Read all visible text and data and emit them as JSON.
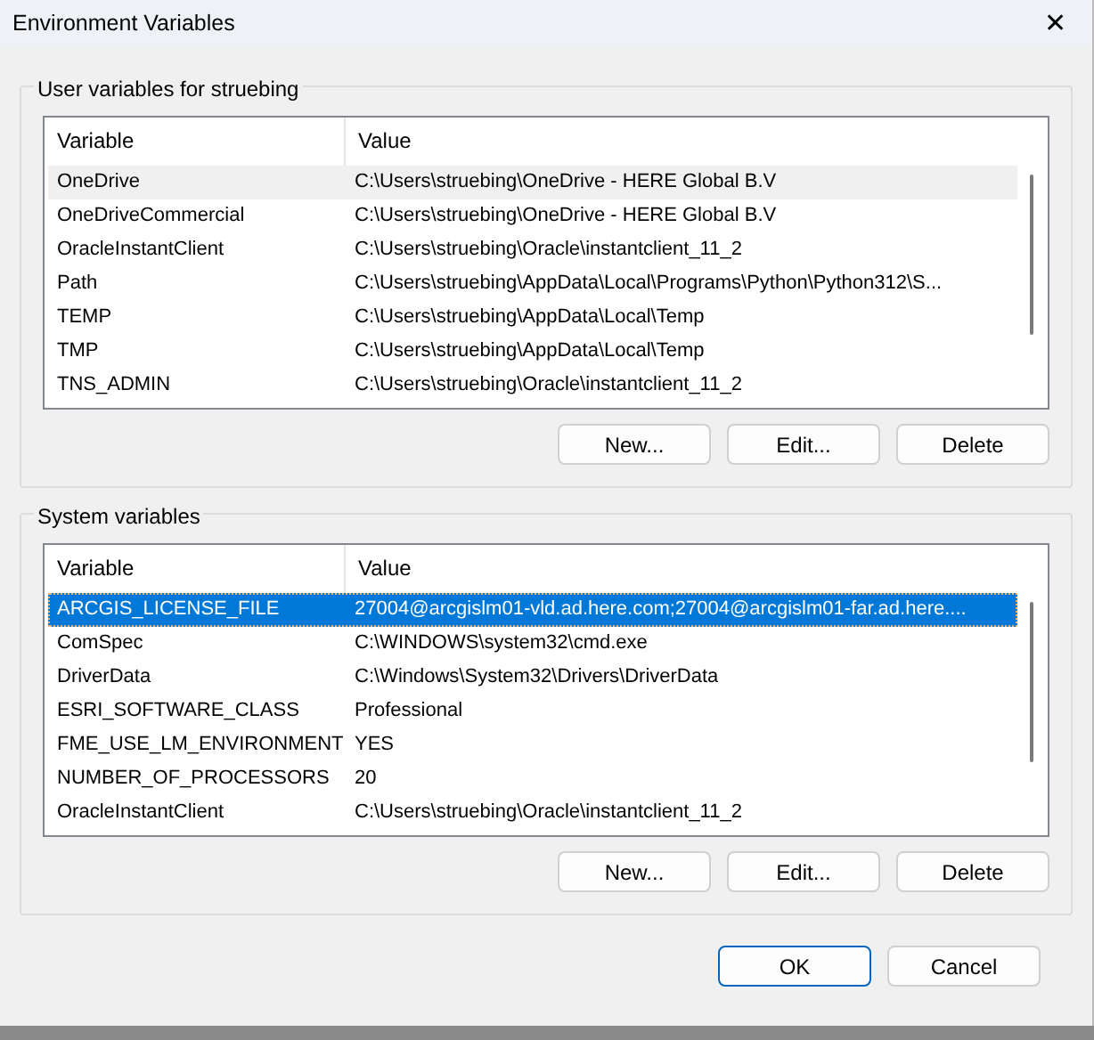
{
  "window": {
    "title": "Environment Variables",
    "close_glyph": "✕"
  },
  "groups": [
    {
      "title": "User variables for struebing",
      "focused": false,
      "columns": [
        "Variable",
        "Value"
      ],
      "rows": [
        {
          "variable": "OneDrive",
          "value": "C:\\Users\\struebing\\OneDrive - HERE Global B.V",
          "selected": true
        },
        {
          "variable": "OneDriveCommercial",
          "value": "C:\\Users\\struebing\\OneDrive - HERE Global B.V",
          "selected": false
        },
        {
          "variable": "OracleInstantClient",
          "value": "C:\\Users\\struebing\\Oracle\\instantclient_11_2",
          "selected": false
        },
        {
          "variable": "Path",
          "value": "C:\\Users\\struebing\\AppData\\Local\\Programs\\Python\\Python312\\S...",
          "selected": false
        },
        {
          "variable": "TEMP",
          "value": "C:\\Users\\struebing\\AppData\\Local\\Temp",
          "selected": false
        },
        {
          "variable": "TMP",
          "value": "C:\\Users\\struebing\\AppData\\Local\\Temp",
          "selected": false
        },
        {
          "variable": "TNS_ADMIN",
          "value": "C:\\Users\\struebing\\Oracle\\instantclient_11_2",
          "selected": false
        }
      ],
      "buttons": [
        "New...",
        "Edit...",
        "Delete"
      ]
    },
    {
      "title": "System variables",
      "focused": true,
      "columns": [
        "Variable",
        "Value"
      ],
      "rows": [
        {
          "variable": "ARCGIS_LICENSE_FILE",
          "value": "27004@arcgislm01-vld.ad.here.com;27004@arcgislm01-far.ad.here....",
          "selected": true
        },
        {
          "variable": "ComSpec",
          "value": "C:\\WINDOWS\\system32\\cmd.exe",
          "selected": false
        },
        {
          "variable": "DriverData",
          "value": "C:\\Windows\\System32\\Drivers\\DriverData",
          "selected": false
        },
        {
          "variable": "ESRI_SOFTWARE_CLASS",
          "value": "Professional",
          "selected": false
        },
        {
          "variable": "FME_USE_LM_ENVIRONMENT",
          "value": "YES",
          "selected": false
        },
        {
          "variable": "NUMBER_OF_PROCESSORS",
          "value": "20",
          "selected": false
        },
        {
          "variable": "OracleInstantClient",
          "value": "C:\\Users\\struebing\\Oracle\\instantclient_11_2",
          "selected": false
        }
      ],
      "buttons": [
        "New...",
        "Edit...",
        "Delete"
      ]
    }
  ],
  "dialog_buttons": [
    {
      "label": "OK",
      "default": true
    },
    {
      "label": "Cancel",
      "default": false
    }
  ]
}
